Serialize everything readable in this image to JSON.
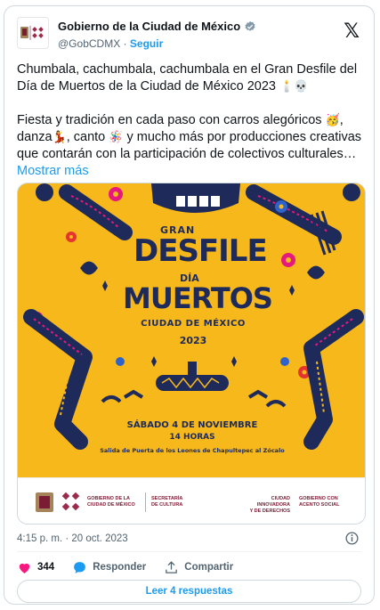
{
  "account": {
    "name": "Gobierno de la Ciudad de México",
    "handle": "@GobCDMX",
    "separator": "·",
    "follow_label": "Seguir",
    "verified_icon": "verified-badge-icon",
    "logo_icon": "x-logo-icon"
  },
  "tweet": {
    "paragraph1": "Chumbala, cachumbala, cachumbala en el Gran Desfile del Día de Muertos de la Ciudad de México 2023",
    "paragraph1_emojis": "🕯️💀",
    "p2_a": "Fiesta y tradición en cada paso con carros alegóricos",
    "p2_emoji1": "🥳",
    "p2_b": ", danza",
    "p2_emoji2": "💃",
    "p2_c": ",  canto",
    "p2_emoji3": "🪅",
    "p2_d": " y mucho más por producciones creativas que contarán con la participación de colectivos culturales…",
    "more_label": "Mostrar más"
  },
  "poster": {
    "title_gran": "GRAN",
    "title_desfile": "DESFILE",
    "title_dia": "DÍA",
    "title_muertos": "MUERTOS",
    "title_city": "CIUDAD DE MÉXICO",
    "title_year": "2023",
    "date": "SÁBADO 4 DE NOVIEMBRE",
    "time": "14 HORAS",
    "route": "Salida de Puerta de los Leones de Chapultepec al Zócalo",
    "colors": {
      "background": "#f7b81c",
      "navy": "#1d2a5a",
      "pink": "#e6197e",
      "red": "#e3342f",
      "blue": "#2f63c9"
    }
  },
  "poster_footer": {
    "gov_line1": "GOBIERNO DE LA",
    "gov_line2": "CIUDAD DE MÉXICO",
    "sec_line1": "SECRETARÍA",
    "sec_line2": "DE CULTURA",
    "slogan1_line1": "CIUDAD INNOVADORA",
    "slogan1_line2": "Y DE DERECHOS",
    "slogan2_line1": "GOBIERNO CON",
    "slogan2_line2": "ACENTO SOCIAL"
  },
  "meta": {
    "timestamp": "4:15 p. m. · 20 oct. 2023"
  },
  "actions": {
    "like_count": "344",
    "reply_label": "Responder",
    "share_label": "Compartir"
  },
  "replies_button": "Leer 4 respuestas"
}
